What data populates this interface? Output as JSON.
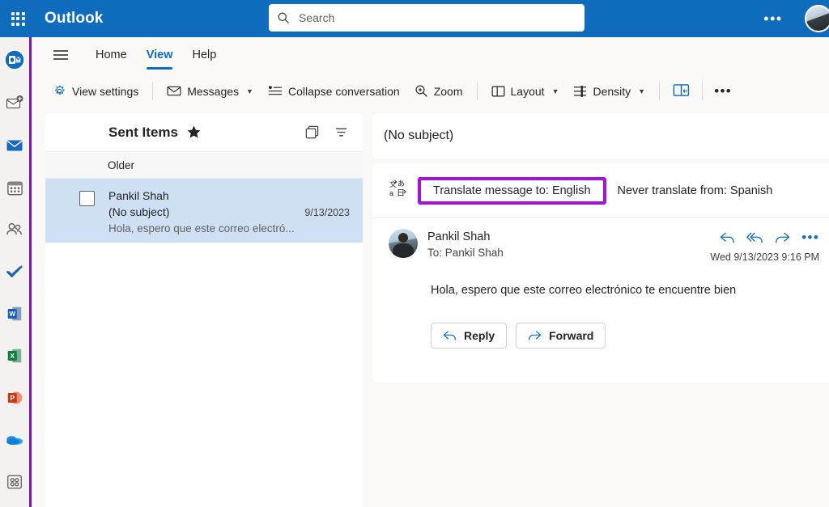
{
  "app": {
    "brand": "Outlook",
    "waffle_icon": "app-launcher-grid-icon",
    "top_ellipsis": "•••"
  },
  "search": {
    "placeholder": "Search",
    "value": "",
    "icon": "search-icon"
  },
  "ribbon": {
    "hamburger_icon": "hamburger-menu-icon",
    "tabs": [
      {
        "label": "Home",
        "active": false
      },
      {
        "label": "View",
        "active": true
      },
      {
        "label": "Help",
        "active": false
      }
    ],
    "commands": [
      {
        "label": "View settings",
        "icon": "gear-icon",
        "caret": false
      },
      {
        "label": "Messages",
        "icon": "envelope-icon",
        "caret": true
      },
      {
        "label": "Collapse conversation",
        "icon": "collapse-conversation-icon",
        "caret": false
      },
      {
        "label": "Zoom",
        "icon": "magnifier-plus-icon",
        "caret": false
      },
      {
        "label": "Layout",
        "icon": "layout-panel-icon",
        "caret": true
      },
      {
        "label": "Density",
        "icon": "density-lines-icon",
        "caret": true
      }
    ],
    "immersive_reader_icon": "immersive-reader-icon",
    "overflow": "•••"
  },
  "rail": {
    "items": [
      {
        "name": "outlook-logo-icon",
        "label": "Outlook"
      },
      {
        "name": "new-mail-icon",
        "label": "New mail"
      },
      {
        "name": "mail-icon",
        "label": "Mail"
      },
      {
        "name": "calendar-icon",
        "label": "Calendar"
      },
      {
        "name": "people-icon",
        "label": "People"
      },
      {
        "name": "todo-icon",
        "label": "To Do"
      },
      {
        "name": "word-icon",
        "label": "Word"
      },
      {
        "name": "excel-icon",
        "label": "Excel"
      },
      {
        "name": "powerpoint-icon",
        "label": "PowerPoint"
      },
      {
        "name": "onedrive-icon",
        "label": "OneDrive"
      },
      {
        "name": "more-apps-icon",
        "label": "More apps"
      }
    ]
  },
  "list": {
    "folder_title": "Sent Items",
    "star_icon": "favorite-star-icon",
    "conversation_toggle_icon": "conversation-view-icon",
    "filter_icon": "filter-icon",
    "group_label": "Older",
    "messages": [
      {
        "sender": "Pankil Shah",
        "subject": "(No subject)",
        "date": "9/13/2023",
        "preview": "Hola, espero que este correo electró...",
        "selected": true
      }
    ]
  },
  "reading_pane": {
    "subject": "(No subject)",
    "translate": {
      "icon": "translate-icon",
      "translate_label": "Translate message to: English",
      "never_label": "Never translate from: Spanish",
      "highlight_color": "#a613d8"
    },
    "message": {
      "avatar": "sender-avatar",
      "from": "Pankil Shah",
      "to": "To:  Pankil Shah",
      "timestamp": "Wed 9/13/2023 9:16 PM",
      "body": "Hola, espero que este correo electrónico te encuentre bien",
      "actions": [
        {
          "name": "reply-icon",
          "label": "Reply"
        },
        {
          "name": "reply-all-icon",
          "label": "Reply all"
        },
        {
          "name": "forward-icon",
          "label": "Forward"
        }
      ],
      "overflow": "•••"
    },
    "buttons": [
      {
        "label": "Reply",
        "icon": "reply-icon"
      },
      {
        "label": "Forward",
        "icon": "forward-icon"
      }
    ]
  },
  "colors": {
    "header_blue": "#0f6cbd",
    "selection_blue": "#cfe0f5",
    "rail_accent": "#7719aa",
    "highlight_purple": "#a613d8"
  }
}
